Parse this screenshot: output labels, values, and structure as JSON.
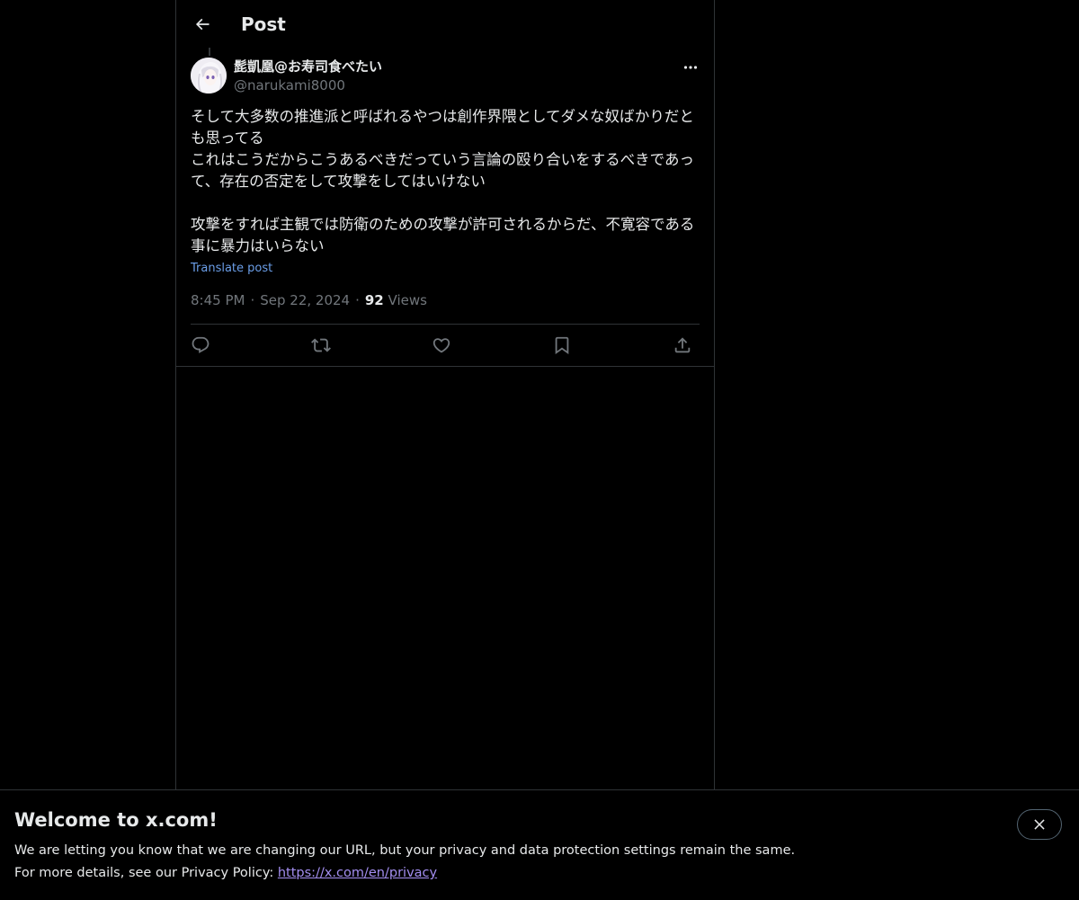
{
  "header": {
    "title": "Post",
    "back_icon": "arrow-left-icon"
  },
  "post": {
    "author": {
      "display_name": "髭凱凰@お寿司食べたい",
      "handle": "@narukami8000",
      "avatar": "avatar-image"
    },
    "text": "そして大多数の推進派と呼ばれるやつは創作界隈としてダメな奴ばかりだとも思ってる\nこれはこうだからこうあるべきだっていう言論の殴り合いをするべきであって、存在の否定をして攻撃をしてはいけない\n\n攻撃をすれば主観では防衛のための攻撃が許可されるからだ、不寛容である事に暴力はいらない",
    "translate_label": "Translate post",
    "time": "8:45 PM",
    "date": "Sep 22, 2024",
    "separator": "·",
    "views_count": "92",
    "views_label": "Views",
    "actions": [
      {
        "name": "reply",
        "icon": "reply-icon"
      },
      {
        "name": "repost",
        "icon": "repost-icon"
      },
      {
        "name": "like",
        "icon": "heart-icon"
      },
      {
        "name": "bookmark",
        "icon": "bookmark-icon"
      },
      {
        "name": "share",
        "icon": "share-icon"
      }
    ]
  },
  "banner": {
    "title": "Welcome to x.com!",
    "line1": "We are letting you know that we are changing our URL, but your privacy and data protection settings remain the same.",
    "line2_prefix": "For more details, see our Privacy Policy: ",
    "link_text": "https://x.com/en/privacy",
    "close_icon": "close-icon"
  },
  "colors": {
    "background": "#000000",
    "text_primary": "#e7e9ea",
    "text_secondary": "#71767b",
    "border": "#2f3336",
    "link": "#6b9ee8",
    "banner_link": "#a38ef0"
  }
}
